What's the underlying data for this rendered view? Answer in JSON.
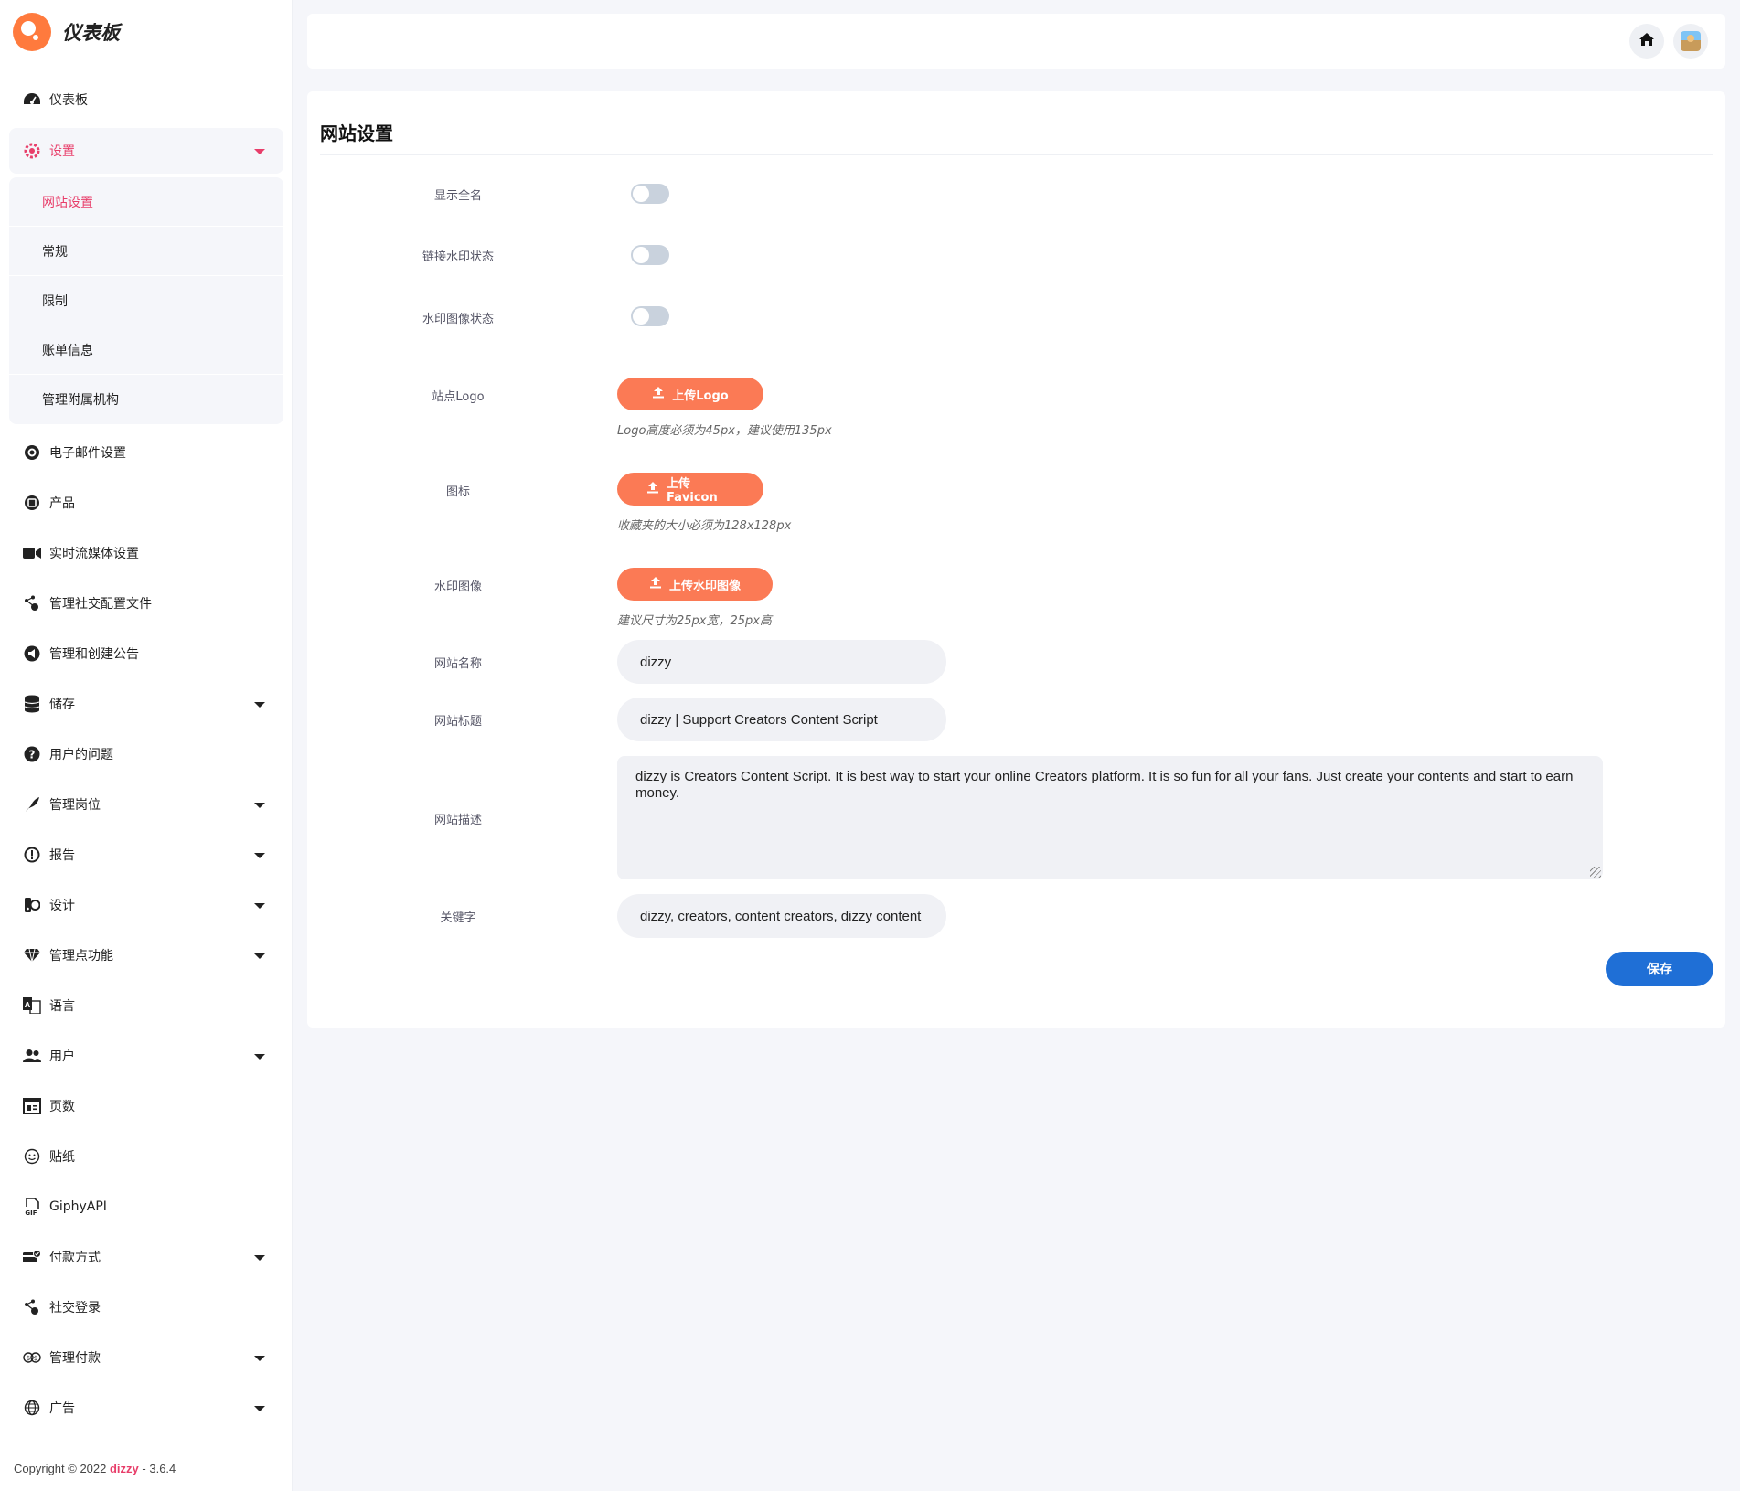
{
  "brand": {
    "name": "仪表板"
  },
  "sidebar": {
    "top_item": {
      "label": "仪表板",
      "icon": "dashboard-icon"
    },
    "settings": {
      "label": "设置",
      "icon": "gear-icon"
    },
    "submenu": [
      "网站设置",
      "常规",
      "限制",
      "账单信息",
      "管理附属机构"
    ],
    "items": [
      {
        "label": "电子邮件设置",
        "icon": "at-icon",
        "caret": false
      },
      {
        "label": "产品",
        "icon": "product-icon",
        "caret": false
      },
      {
        "label": "实时流媒体设置",
        "icon": "video-camera-icon",
        "caret": false
      },
      {
        "label": "管理社交配置文件",
        "icon": "share-icon",
        "caret": false
      },
      {
        "label": "管理和创建公告",
        "icon": "megaphone-icon",
        "caret": false
      },
      {
        "label": "储存",
        "icon": "database-icon",
        "caret": true
      },
      {
        "label": "用户的问题",
        "icon": "question-icon",
        "caret": false
      },
      {
        "label": "管理岗位",
        "icon": "feather-icon",
        "caret": true
      },
      {
        "label": "报告",
        "icon": "exclamation-icon",
        "caret": true
      },
      {
        "label": "设计",
        "icon": "palette-icon",
        "caret": true
      },
      {
        "label": "管理点功能",
        "icon": "diamond-icon",
        "caret": true
      },
      {
        "label": "语言",
        "icon": "translate-icon",
        "caret": false
      },
      {
        "label": "用户",
        "icon": "users-icon",
        "caret": true
      },
      {
        "label": "页数",
        "icon": "newspaper-icon",
        "caret": false
      },
      {
        "label": "贴纸",
        "icon": "sticker-icon",
        "caret": false
      },
      {
        "label": "GiphyAPI",
        "icon": "gif-icon",
        "caret": false
      },
      {
        "label": "付款方式",
        "icon": "payment-card-icon",
        "caret": true
      },
      {
        "label": "社交登录",
        "icon": "share-icon",
        "caret": false
      },
      {
        "label": "管理付款",
        "icon": "money-icon",
        "caret": true
      },
      {
        "label": "广告",
        "icon": "globe-icon",
        "caret": true
      }
    ]
  },
  "copyright": {
    "prefix": "Copyright © 2022",
    "brand": "dizzy",
    "version": "- 3.6.4"
  },
  "topbar": {
    "home_icon": "home-icon",
    "avatar_icon": "user-avatar-icon"
  },
  "page": {
    "title": "网站设置",
    "toggles": [
      {
        "label": "显示全名",
        "on": false
      },
      {
        "label": "链接水印状态",
        "on": false
      },
      {
        "label": "水印图像状态",
        "on": false
      }
    ],
    "uploads": [
      {
        "label": "站点Logo",
        "button": "上传Logo",
        "hint": "Logo高度必须为45px，建议使用135px"
      },
      {
        "label": "图标",
        "button": "上传Favicon",
        "hint": "收藏夹的大小必须为128x128px"
      },
      {
        "label": "水印图像",
        "button": "上传水印图像",
        "hint": "建议尺寸为25px宽，25px高"
      }
    ],
    "site_name": {
      "label": "网站名称",
      "value": "dizzy"
    },
    "site_title": {
      "label": "网站标题",
      "value": "dizzy | Support Creators Content Script"
    },
    "site_description": {
      "label": "网站描述",
      "value": "dizzy is Creators Content Script. It is best way to start your online Creators platform. It is so fun for all your fans. Just create your contents and start to earn money."
    },
    "keywords": {
      "label": "关键字",
      "value": "dizzy, creators, content creators, dizzy content"
    },
    "save_label": "保存"
  },
  "colors": {
    "accent": "#e83e6a",
    "upload_button": "#fb7a55",
    "save_button": "#1f6fd6",
    "brand_logo": "#ff7a3d"
  }
}
